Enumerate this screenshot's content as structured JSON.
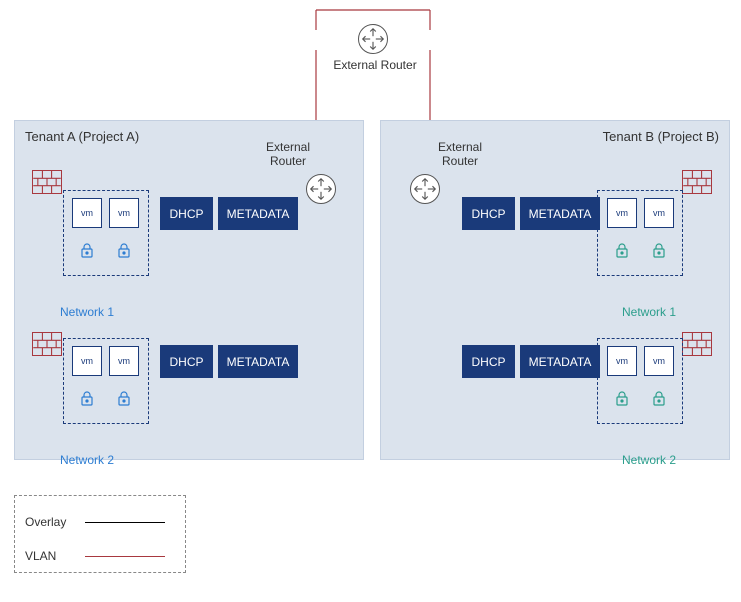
{
  "external_router_top": "External Router",
  "external_router_left": "External\nRouter",
  "external_router_right": "External\nRouter",
  "tenants": {
    "a": {
      "title": "Tenant A (Project A)",
      "net1": "Network 1",
      "net2": "Network 2",
      "dhcp": "DHCP",
      "metadata": "METADATA",
      "vm": "vm"
    },
    "b": {
      "title": "Tenant B (Project B)",
      "net1": "Network 1",
      "net2": "Network 2",
      "dhcp": "DHCP",
      "metadata": "METADATA",
      "vm": "vm"
    }
  },
  "legend": {
    "overlay": "Overlay",
    "vlan": "VLAN"
  },
  "colors": {
    "tenant_a_net": "#2d7dd2",
    "tenant_b_net": "#2b9e8c",
    "firewall": "#a8383f",
    "box": "#1a3a7a",
    "vlan_line": "#a8383f",
    "overlay_line": "#000000"
  }
}
